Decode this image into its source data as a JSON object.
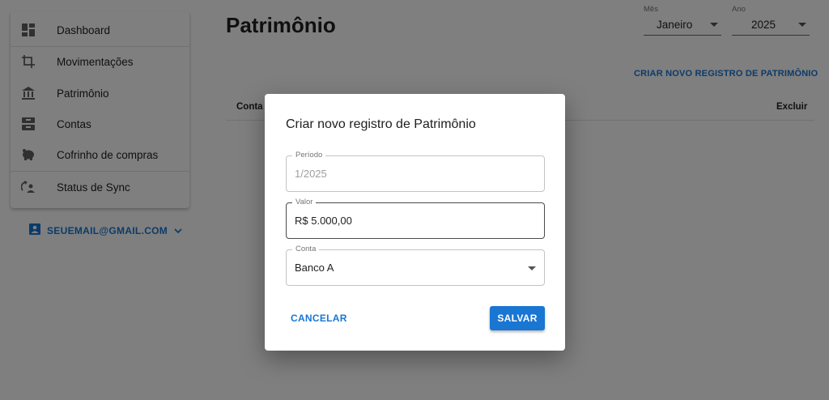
{
  "sidebar": {
    "items": [
      {
        "label": "Dashboard",
        "icon": "dashboard-icon"
      },
      {
        "label": "Movimentações",
        "icon": "crop-icon"
      },
      {
        "label": "Patrimônio",
        "icon": "bank-icon"
      },
      {
        "label": "Contas",
        "icon": "inbox-icon"
      },
      {
        "label": "Cofrinho de compras",
        "icon": "piggy-bank-icon"
      },
      {
        "label": "Status de Sync",
        "icon": "sync-status-icon"
      }
    ],
    "account": {
      "label": "SEUEMAIL@GMAIL.COM",
      "icon": "account-box-icon"
    }
  },
  "header": {
    "title": "Patrimônio",
    "month": {
      "caption": "Mês",
      "value": "Janeiro"
    },
    "year": {
      "caption": "Ano",
      "value": "2025"
    },
    "create_link": "CRIAR NOVO REGISTRO DE PATRIMÔNIO"
  },
  "table": {
    "columns": [
      "Conta",
      "Excluir"
    ]
  },
  "dialog": {
    "title": "Criar novo registro de Patrimônio",
    "period": {
      "label": "Período",
      "value": "1/2025"
    },
    "value": {
      "label": "Valor",
      "value": "R$ 5.000,00"
    },
    "account": {
      "label": "Conta",
      "value": "Banco A"
    },
    "cancel_label": "CANCELAR",
    "save_label": "SALVAR"
  },
  "colors": {
    "accent": "#1976d2",
    "backdrop": "rgba(0,0,0,0.5)"
  }
}
